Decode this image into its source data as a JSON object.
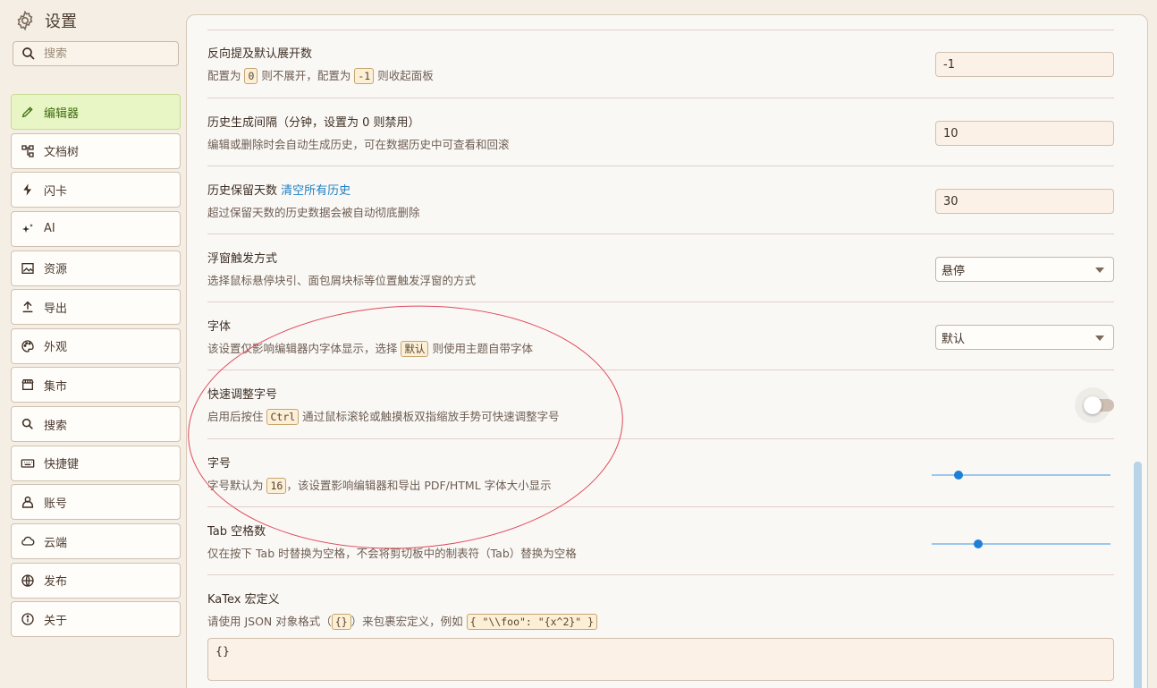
{
  "app": {
    "title": "设置"
  },
  "search": {
    "placeholder": "搜索"
  },
  "sidebar": {
    "items": [
      {
        "label": "编辑器",
        "icon": "pencil-icon",
        "active": true
      },
      {
        "label": "文档树",
        "icon": "tree-icon"
      },
      {
        "label": "闪卡",
        "icon": "bolt-icon"
      },
      {
        "label": "AI",
        "icon": "sparkle-icon"
      },
      {
        "label": "资源",
        "icon": "image-icon"
      },
      {
        "label": "导出",
        "icon": "upload-icon"
      },
      {
        "label": "外观",
        "icon": "palette-icon"
      },
      {
        "label": "集市",
        "icon": "store-icon"
      },
      {
        "label": "搜索",
        "icon": "search-icon"
      },
      {
        "label": "快捷键",
        "icon": "keyboard-icon"
      },
      {
        "label": "账号",
        "icon": "user-icon"
      },
      {
        "label": "云端",
        "icon": "cloud-icon"
      },
      {
        "label": "发布",
        "icon": "globe-icon"
      },
      {
        "label": "关于",
        "icon": "info-icon"
      }
    ]
  },
  "settings": {
    "backlink": {
      "title": "反向提及默认展开数",
      "desc_a": "配置为 ",
      "code_a": "0",
      "desc_b": " 则不展开，配置为 ",
      "code_b": "-1",
      "desc_c": " 则收起面板",
      "value": "-1"
    },
    "history_interval": {
      "title": "历史生成间隔（分钟，设置为 0 则禁用）",
      "desc": "编辑或删除时会自动生成历史，可在数据历史中可查看和回滚",
      "value": "10"
    },
    "history_keep": {
      "title": "历史保留天数 ",
      "link": "清空所有历史",
      "desc": "超过保留天数的历史数据会被自动彻底删除",
      "value": "30"
    },
    "float_trigger": {
      "title": "浮窗触发方式",
      "desc": "选择鼠标悬停块引、面包屑块标等位置触发浮窗的方式",
      "value": "悬停"
    },
    "font": {
      "title": "字体",
      "desc_a": "该设置仅影响编辑器内字体显示，选择 ",
      "code": "默认",
      "desc_b": " 则使用主题自带字体",
      "value": "默认"
    },
    "quick_font": {
      "title": "快速调整字号",
      "desc_a": "启用后按住 ",
      "code": "Ctrl",
      "desc_b": " 通过鼠标滚轮或触摸板双指缩放手势可快速调整字号",
      "enabled": false
    },
    "font_size": {
      "title": "字号",
      "desc_a": "字号默认为 ",
      "code": "16",
      "desc_b": "，该设置影响编辑器和导出 PDF/HTML 字体大小显示",
      "slider_fraction": 0.15
    },
    "tab_space": {
      "title": "Tab 空格数",
      "desc": "仅在按下 Tab 时替换为空格，不会将剪切板中的制表符（Tab）替换为空格",
      "slider_fraction": 0.26
    },
    "katex": {
      "title": "KaTex 宏定义",
      "desc_a": "请使用 JSON 对象格式（",
      "code_a": "{}",
      "desc_b": "）来包裹宏定义，例如 ",
      "code_b": "{ \"\\\\foo\": \"{x^2}\" }",
      "value": "{}"
    }
  },
  "colors": {
    "accent": "#1e7fd6",
    "active_nav": "#e8f5c4",
    "annotation": "#e0485a"
  }
}
